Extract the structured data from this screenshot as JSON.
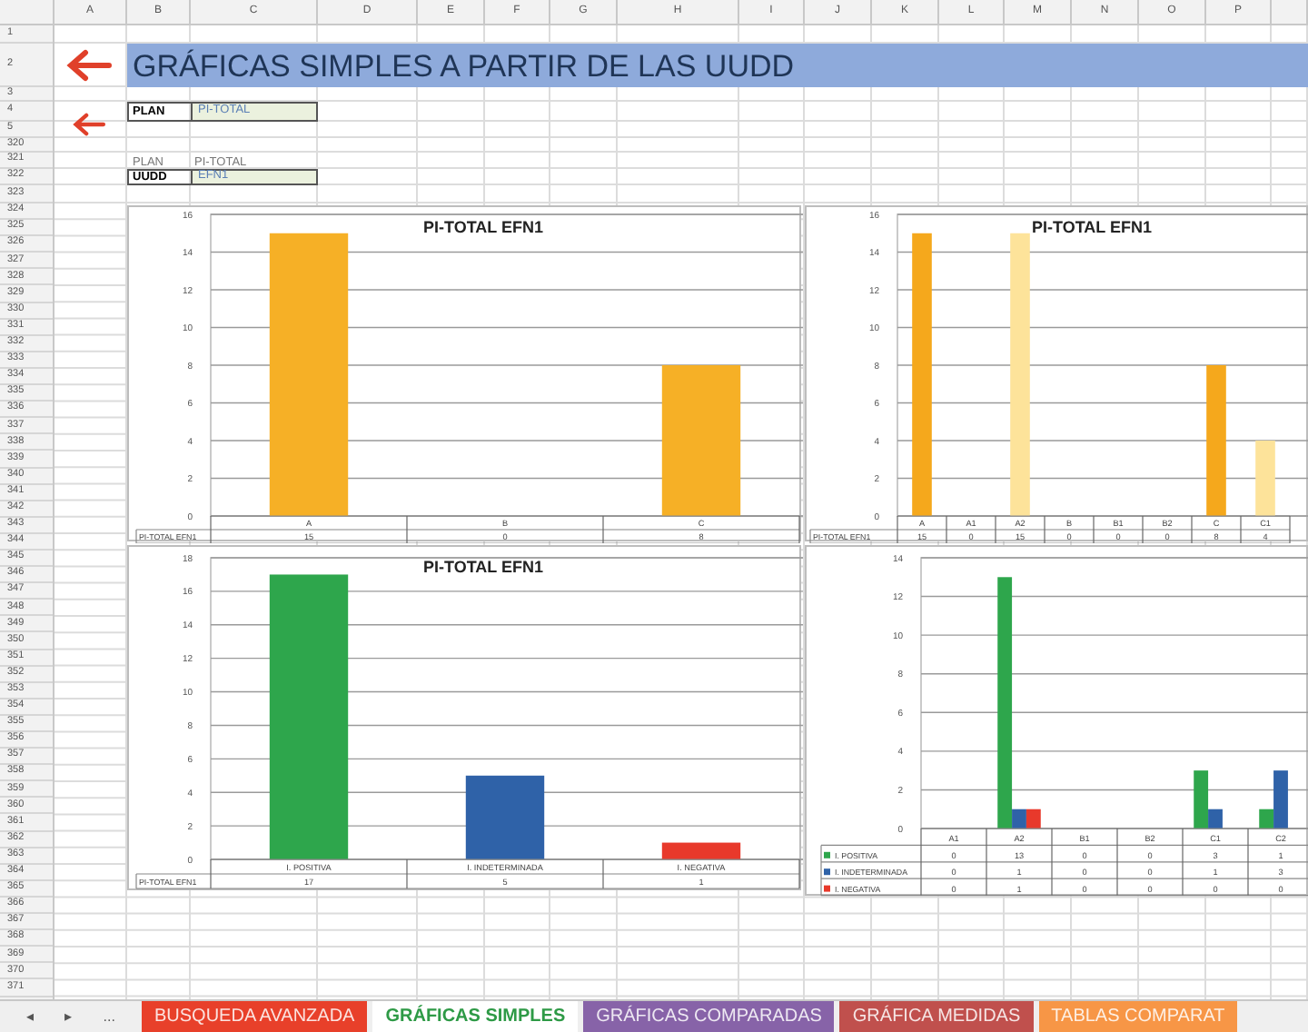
{
  "column_headers": [
    "A",
    "B",
    "C",
    "D",
    "E",
    "F",
    "G",
    "H",
    "I",
    "J",
    "K",
    "L",
    "M",
    "N",
    "O",
    "P"
  ],
  "row_headers": [
    "1",
    "2",
    "3",
    "4",
    "5",
    "320",
    "321",
    "322",
    "323",
    "324",
    "325",
    "326",
    "327",
    "328",
    "329",
    "330",
    "331",
    "332",
    "333",
    "334",
    "335",
    "336",
    "337",
    "338",
    "339",
    "340",
    "341",
    "342",
    "343",
    "344",
    "345",
    "346",
    "347",
    "348",
    "349",
    "350",
    "351",
    "352",
    "353",
    "354",
    "355",
    "356",
    "357",
    "358",
    "359",
    "360",
    "361",
    "362",
    "363",
    "364",
    "365",
    "366",
    "367",
    "368",
    "369",
    "370",
    "371"
  ],
  "title": "GRÁFICAS SIMPLES A PARTIR DE LAS UUDD",
  "plan_field": {
    "label": "PLAN",
    "value": "PI-TOTAL"
  },
  "selection_info": {
    "label": "PLAN",
    "value": "PI-TOTAL"
  },
  "uudd_field": {
    "label": "UUDD",
    "value": "EFN1"
  },
  "charts": [
    {
      "chart_data": {
        "type": "bar",
        "title": "PI-TOTAL EFN1",
        "categories": [
          "A",
          "B",
          "C"
        ],
        "series": [
          {
            "name": "PI-TOTAL EFN1",
            "colors": [
              "#f6b026",
              null,
              "#f6b026"
            ],
            "values": [
              15,
              0,
              8
            ]
          }
        ],
        "ylim": [
          0,
          16
        ],
        "yticks": [
          0,
          2,
          4,
          6,
          8,
          10,
          12,
          14,
          16
        ],
        "grid": true
      },
      "data_table": {
        "rows": [
          {
            "cells": [
              "15",
              "0",
              "8"
            ]
          }
        ]
      }
    },
    {
      "chart_data": {
        "type": "bar",
        "title": "PI-TOTAL EFN1",
        "categories": [
          "A",
          "A1",
          "A2",
          "B",
          "B1",
          "B2",
          "C",
          "C1"
        ],
        "series": [
          {
            "name": "PI-TOTAL EFN1",
            "colors": [
              "#f5a81c",
              null,
              "#fde39a",
              null,
              null,
              null,
              "#f5a81c",
              "#fde39a"
            ],
            "values": [
              15,
              0,
              15,
              0,
              0,
              0,
              8,
              4
            ]
          }
        ],
        "ylim": [
          0,
          16
        ],
        "yticks": [
          0,
          2,
          4,
          6,
          8,
          10,
          12,
          14,
          16
        ],
        "grid": true
      },
      "data_table": {
        "rows": [
          {
            "cells": [
              "15",
              "0",
              "15",
              "0",
              "0",
              "0",
              "8",
              "4"
            ]
          }
        ]
      }
    },
    {
      "chart_data": {
        "type": "bar",
        "title": "PI-TOTAL EFN1",
        "categories": [
          "I. POSITIVA",
          "I. INDETERMINADA",
          "I. NEGATIVA"
        ],
        "series": [
          {
            "name": "PI-TOTAL EFN1",
            "colors": [
              "#2ea64c",
              "#2f62a8",
              "#e8392b"
            ],
            "values": [
              17,
              5,
              1
            ]
          }
        ],
        "ylim": [
          0,
          18
        ],
        "yticks": [
          0,
          2,
          4,
          6,
          8,
          10,
          12,
          14,
          16,
          18
        ],
        "grid": true
      },
      "data_table": {
        "rows": [
          {
            "cells": [
              "17",
              "5",
              "1"
            ]
          }
        ]
      }
    },
    {
      "chart_data": {
        "type": "bar",
        "categories": [
          "A1",
          "A2",
          "B1",
          "B2",
          "C1",
          "C2"
        ],
        "series": [
          {
            "name": "I. POSITIVA",
            "color": "#2ea64c",
            "values": [
              0,
              13,
              0,
              0,
              3,
              1
            ]
          },
          {
            "name": "I. INDETERMINADA",
            "color": "#2f62a8",
            "values": [
              0,
              1,
              0,
              0,
              1,
              3
            ]
          },
          {
            "name": "I. NEGATIVA",
            "color": "#e8392b",
            "values": [
              0,
              1,
              0,
              0,
              0,
              0
            ]
          }
        ],
        "ylim": [
          0,
          14
        ],
        "yticks": [
          0,
          2,
          4,
          6,
          8,
          10,
          12,
          14
        ],
        "grid": true,
        "legend": true
      },
      "data_table": {
        "rows": [
          {
            "cells": [
              "0",
              "13",
              "0",
              "0",
              "3",
              "1"
            ]
          },
          {
            "cells": [
              "0",
              "1",
              "0",
              "0",
              "1",
              "3"
            ]
          },
          {
            "cells": [
              "0",
              "1",
              "0",
              "0",
              "0",
              "0"
            ]
          }
        ]
      }
    }
  ],
  "sheet_nav": [
    "◂",
    "▸",
    "..."
  ],
  "tabs": [
    {
      "label": "BUSQUEDA AVANZADA",
      "color": "#e8402a",
      "selected": false
    },
    {
      "label": "GRÁFICAS SIMPLES",
      "color": "#2e9a46",
      "selected": true
    },
    {
      "label": "GRÁFICAS COMPARADAS",
      "color": "#8763a8",
      "selected": false
    },
    {
      "label": "GRÁFICA MEDIDAS",
      "color": "#c0504d",
      "selected": false
    },
    {
      "label": "TABLAS COMPARAT",
      "color": "#f79646",
      "selected": false
    }
  ]
}
